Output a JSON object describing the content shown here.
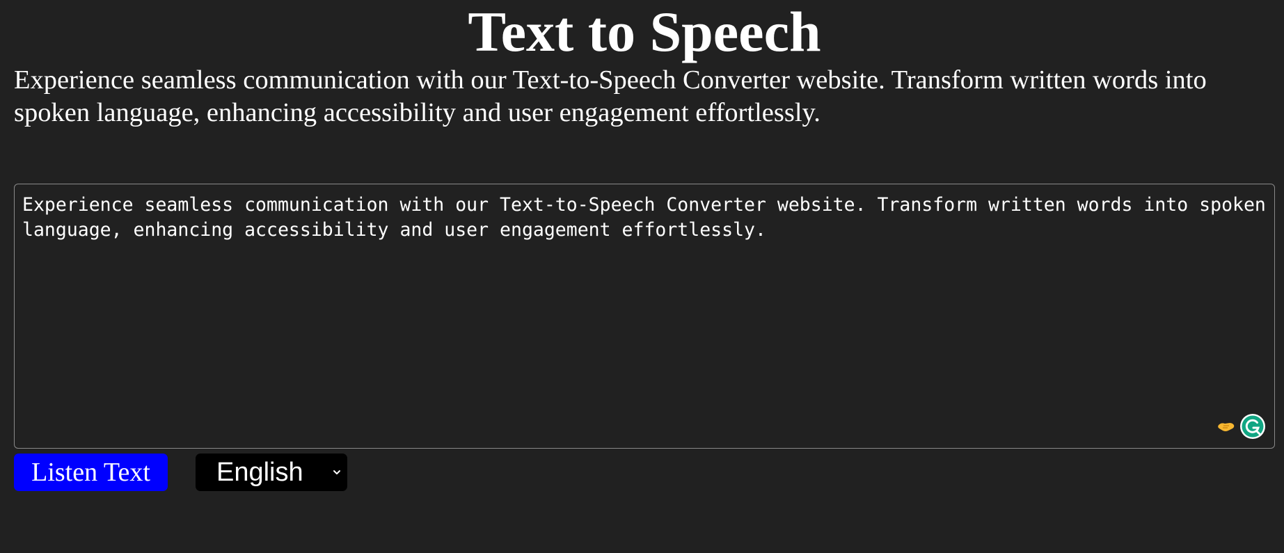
{
  "header": {
    "title": "Text to Speech",
    "description": "Experience seamless communication with our Text-to-Speech Converter website. Transform written words into spoken language, enhancing accessibility and user engagement effortlessly."
  },
  "editor": {
    "value": "Experience seamless communication with our Text-to-Speech Converter website. Transform written words into spoken language, enhancing accessibility and user engagement effortlessly.",
    "icons": [
      "hand-icon",
      "grammarly-icon"
    ]
  },
  "controls": {
    "listen_label": "Listen Text",
    "language_selected": "English"
  },
  "colors": {
    "background": "#212121",
    "button": "#0000ff",
    "select": "#000000",
    "grammarly": "#15c39a"
  }
}
